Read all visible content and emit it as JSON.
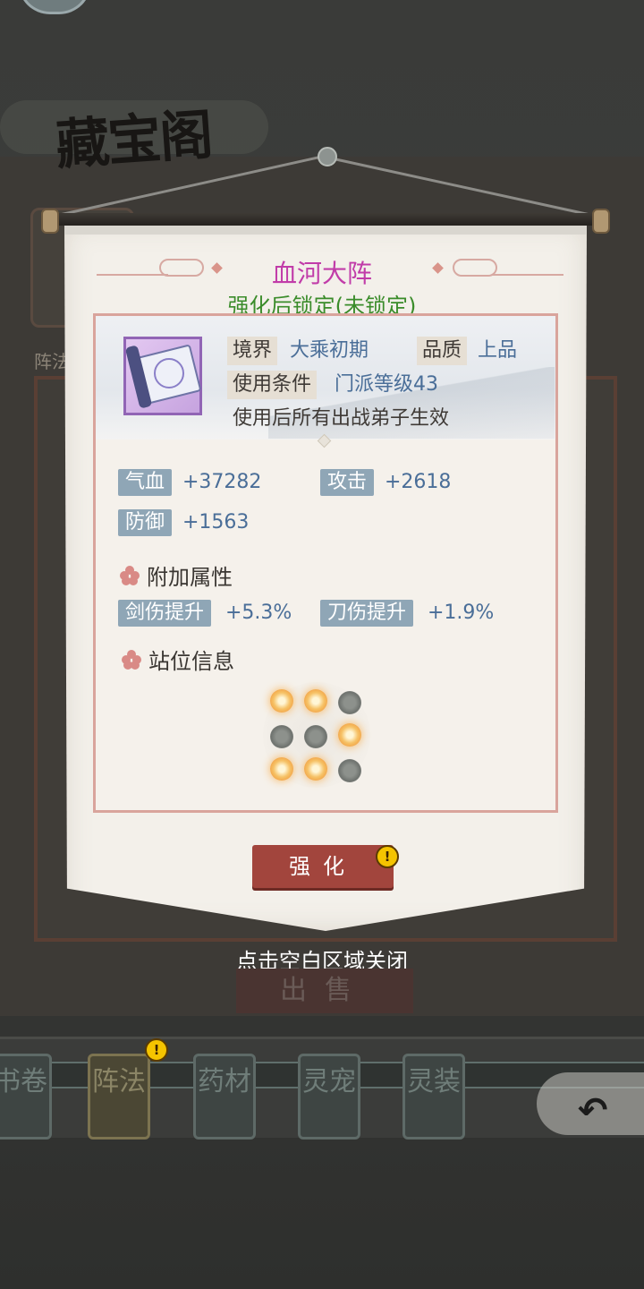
{
  "header": {
    "title": "藏宝阁"
  },
  "background": {
    "side_label": "阵法"
  },
  "modal": {
    "item_name": "血河大阵",
    "lock_status": "强化后锁定(未锁定)",
    "info": {
      "realm_label": "境界",
      "realm_value": "大乘初期",
      "quality_label": "品质",
      "quality_value": "上品",
      "condition_label": "使用条件",
      "condition_value": "门派等级43",
      "effect_text": "使用后所有出战弟子生效"
    },
    "stats": [
      {
        "label": "气血",
        "value": "+37282"
      },
      {
        "label": "攻击",
        "value": "+2618"
      },
      {
        "label": "防御",
        "value": "+1563"
      }
    ],
    "extra_title": "附加属性",
    "extra_stats": [
      {
        "label": "剑伤提升",
        "value": "+5.3%"
      },
      {
        "label": "刀伤提升",
        "value": "+1.9%"
      }
    ],
    "position_title": "站位信息",
    "formation": [
      [
        1,
        1,
        0
      ],
      [
        0,
        0,
        1
      ],
      [
        1,
        1,
        0
      ]
    ],
    "enhance_button": "强化",
    "badge": "!"
  },
  "close_hint": "点击空白区域关闭",
  "sell_button": "出售",
  "tabs": [
    {
      "label": "书卷"
    },
    {
      "label": "阵法"
    },
    {
      "label": "药材"
    },
    {
      "label": "灵宠"
    },
    {
      "label": "灵装"
    }
  ],
  "back_icon": "back-arrow-icon"
}
